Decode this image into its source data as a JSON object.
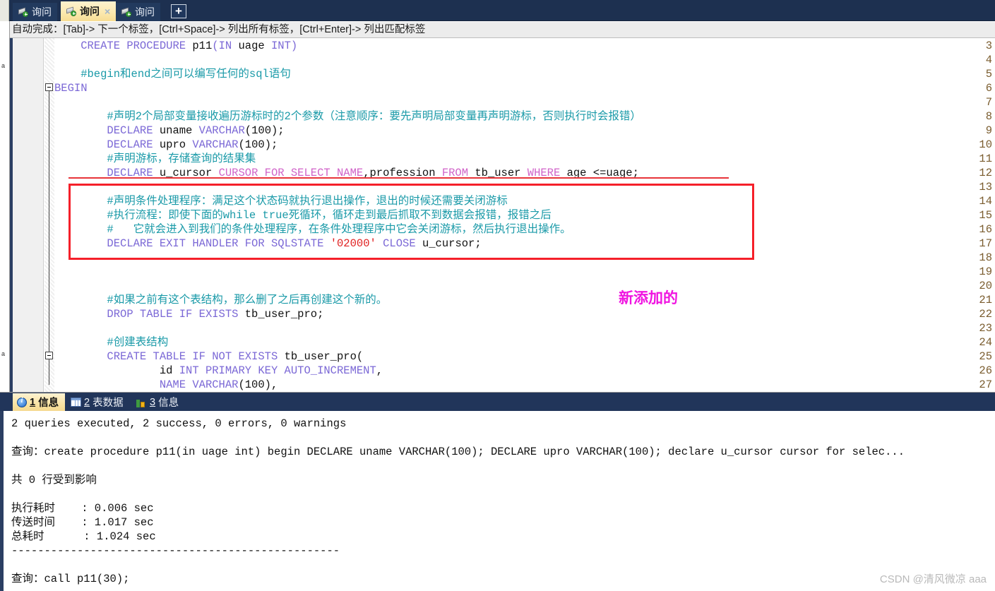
{
  "window": {
    "app_kind": "sql-editor"
  },
  "tabbar": {
    "tabs": [
      {
        "label": "询问",
        "icon": "query-tab-icon",
        "active": false,
        "closable": false
      },
      {
        "label": "询问",
        "icon": "query-tab-icon",
        "active": true,
        "closable": true,
        "close_glyph": "×"
      },
      {
        "label": "询问",
        "icon": "query-tab-icon",
        "active": false,
        "closable": false
      }
    ],
    "add_label": "+"
  },
  "hintbar": {
    "text": "自动完成：[Tab]-> 下一个标签，[Ctrl+Space]-> 列出所有标签，[Ctrl+Enter]-> 列出匹配标签"
  },
  "editor": {
    "left_strip_marks": [
      "a",
      "a"
    ],
    "lines": [
      {
        "no": "3",
        "segs": [
          {
            "t": "    ",
            "c": "plain"
          },
          {
            "t": "CREATE PROCEDURE ",
            "c": "kw"
          },
          {
            "t": "p11",
            "c": "plain"
          },
          {
            "t": "(",
            "c": "kw"
          },
          {
            "t": "IN",
            "c": "kw"
          },
          {
            "t": " uage ",
            "c": "plain"
          },
          {
            "t": "INT",
            "c": "kw"
          },
          {
            "t": ")",
            "c": "kw"
          }
        ]
      },
      {
        "no": "4",
        "segs": []
      },
      {
        "no": "5",
        "segs": [
          {
            "t": "    #begin和end之间可以编写任何的sql语句",
            "c": "cm"
          }
        ]
      },
      {
        "no": "6",
        "segs": [
          {
            "t": "BEGIN",
            "c": "kw"
          }
        ]
      },
      {
        "no": "7",
        "segs": []
      },
      {
        "no": "8",
        "segs": [
          {
            "t": "        #声明2个局部变量接收遍历游标时的2个参数（注意顺序：要先声明局部变量再声明游标，否则执行时会报错）",
            "c": "cm"
          }
        ]
      },
      {
        "no": "9",
        "segs": [
          {
            "t": "        ",
            "c": "plain"
          },
          {
            "t": "DECLARE",
            "c": "kw"
          },
          {
            "t": " uname ",
            "c": "plain"
          },
          {
            "t": "VARCHAR",
            "c": "kw"
          },
          {
            "t": "(100);",
            "c": "plain"
          }
        ]
      },
      {
        "no": "10",
        "segs": [
          {
            "t": "        ",
            "c": "plain"
          },
          {
            "t": "DECLARE",
            "c": "kw"
          },
          {
            "t": " upro ",
            "c": "plain"
          },
          {
            "t": "VARCHAR",
            "c": "kw"
          },
          {
            "t": "(100);",
            "c": "plain"
          }
        ]
      },
      {
        "no": "11",
        "segs": [
          {
            "t": "        #声明游标，存储查询的结果集",
            "c": "cm"
          }
        ]
      },
      {
        "no": "12",
        "segs": [
          {
            "t": "        ",
            "c": "plain"
          },
          {
            "t": "DECLARE",
            "c": "kw"
          },
          {
            "t": " u_cursor ",
            "c": "plain"
          },
          {
            "t": "CURSOR FOR SELECT NAME",
            "c": "kw2"
          },
          {
            "t": ",profession ",
            "c": "plain"
          },
          {
            "t": "FROM",
            "c": "kw2"
          },
          {
            "t": " tb_user ",
            "c": "plain"
          },
          {
            "t": "WHERE",
            "c": "kw2"
          },
          {
            "t": " age <=uage;",
            "c": "plain"
          }
        ]
      },
      {
        "no": "13",
        "segs": []
      },
      {
        "no": "14",
        "segs": [
          {
            "t": "        #声明条件处理程序：满足这个状态码就执行退出操作，退出的时候还需要关闭游标",
            "c": "cm"
          }
        ]
      },
      {
        "no": "15",
        "segs": [
          {
            "t": "        #执行流程：即使下面的while true死循环，循环走到最后抓取不到数据会报错，报错之后",
            "c": "cm"
          }
        ]
      },
      {
        "no": "16",
        "segs": [
          {
            "t": "        #   它就会进入到我们的条件处理程序，在条件处理程序中它会关闭游标，然后执行退出操作。",
            "c": "cm"
          }
        ]
      },
      {
        "no": "17",
        "segs": [
          {
            "t": "        ",
            "c": "plain"
          },
          {
            "t": "DECLARE EXIT HANDLER FOR SQLSTATE",
            "c": "kw"
          },
          {
            "t": " ",
            "c": "plain"
          },
          {
            "t": "'02000'",
            "c": "str"
          },
          {
            "t": " ",
            "c": "plain"
          },
          {
            "t": "CLOSE",
            "c": "kw"
          },
          {
            "t": " u_cursor;",
            "c": "plain"
          }
        ]
      },
      {
        "no": "18",
        "segs": []
      },
      {
        "no": "19",
        "segs": []
      },
      {
        "no": "20",
        "segs": []
      },
      {
        "no": "21",
        "segs": [
          {
            "t": "        #如果之前有这个表结构，那么删了之后再创建这个新的。",
            "c": "cm"
          }
        ]
      },
      {
        "no": "22",
        "segs": [
          {
            "t": "        ",
            "c": "plain"
          },
          {
            "t": "DROP TABLE IF EXISTS",
            "c": "kw"
          },
          {
            "t": " tb_user_pro;",
            "c": "plain"
          }
        ]
      },
      {
        "no": "23",
        "segs": []
      },
      {
        "no": "24",
        "segs": [
          {
            "t": "        #创建表结构",
            "c": "cm"
          }
        ]
      },
      {
        "no": "25",
        "segs": [
          {
            "t": "        ",
            "c": "plain"
          },
          {
            "t": "CREATE TABLE IF NOT EXISTS",
            "c": "kw"
          },
          {
            "t": " tb_user_pro(",
            "c": "plain"
          }
        ]
      },
      {
        "no": "26",
        "segs": [
          {
            "t": "                id ",
            "c": "plain"
          },
          {
            "t": "INT PRIMARY KEY AUTO_INCREMENT",
            "c": "kw"
          },
          {
            "t": ",",
            "c": "plain"
          }
        ]
      },
      {
        "no": "27",
        "segs": [
          {
            "t": "                ",
            "c": "plain"
          },
          {
            "t": "NAME VARCHAR",
            "c": "kw"
          },
          {
            "t": "(100),",
            "c": "plain"
          }
        ]
      }
    ],
    "annotation": {
      "note_text": "新添加的",
      "note_color": "#f014e1",
      "box_color": "#f5202a"
    }
  },
  "results": {
    "tabs": [
      {
        "num": "1",
        "label": "信息",
        "icon": "info-icon",
        "active": true
      },
      {
        "num": "2",
        "label": "表数据",
        "icon": "grid-icon",
        "active": false
      },
      {
        "num": "3",
        "label": "信息",
        "icon": "chart-icon",
        "active": false
      }
    ],
    "lines": [
      "2 queries executed, 2 success, 0 errors, 0 warnings",
      "",
      "查询：create procedure p11(in uage int) begin DECLARE uname VARCHAR(100); DECLARE upro VARCHAR(100); declare u_cursor cursor for selec...",
      "",
      "共 0 行受到影响",
      "",
      "执行耗时    : 0.006 sec",
      "传送时间    : 1.017 sec",
      "总耗时      : 1.024 sec",
      "--------------------------------------------------",
      "",
      "查询：call p11(30);"
    ]
  },
  "watermark": {
    "text": "CSDN @清风微凉 aaa"
  }
}
